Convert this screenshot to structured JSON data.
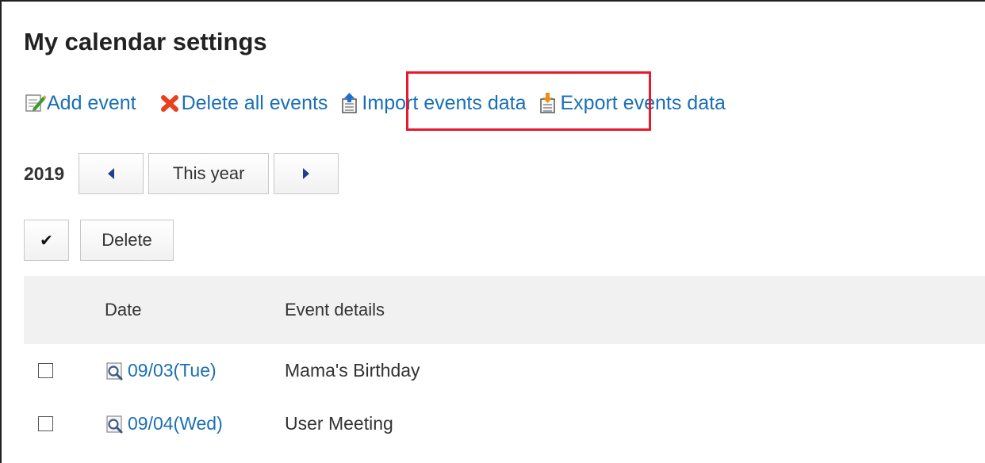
{
  "page": {
    "title": "My calendar settings"
  },
  "actions": {
    "add_event": "Add event",
    "delete_all": "Delete all events",
    "import": "Import events data",
    "export": "Export events data"
  },
  "highlight_color": "#e8192c",
  "link_color": "#1a6fb5",
  "year_nav": {
    "year": "2019",
    "prev_icon": "triangle-left",
    "this_year": "This year",
    "next_icon": "triangle-right"
  },
  "selection": {
    "select_all": "✔",
    "delete": "Delete"
  },
  "table": {
    "columns": [
      "Date",
      "Event details"
    ],
    "rows": [
      {
        "date": "09/03(Tue)",
        "details": "Mama's Birthday",
        "checked": false
      },
      {
        "date": "09/04(Wed)",
        "details": "User Meeting",
        "checked": false
      }
    ]
  }
}
